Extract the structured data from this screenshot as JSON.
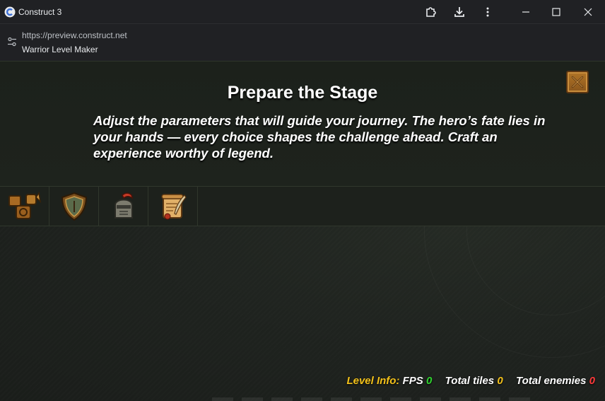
{
  "window": {
    "title": "Construct 3",
    "controls": {
      "extensions_icon": "puzzle-icon",
      "download_icon": "download-icon",
      "menu_icon": "more-vert-icon",
      "minimize_icon": "minimize-icon",
      "maximize_icon": "maximize-icon",
      "close_icon": "close-icon"
    }
  },
  "address": {
    "url": "https://preview.construct.net",
    "page_title": "Warrior Level Maker"
  },
  "game": {
    "title": "Prepare the Stage",
    "description": "Adjust the parameters that will guide your journey. The hero’s fate lies in your hands — every choice shapes the challenge ahead. Craft an experience worthy of legend.",
    "tabs": [
      {
        "icon": "map-layout-icon"
      },
      {
        "icon": "shield-icon"
      },
      {
        "icon": "knight-helmet-icon"
      },
      {
        "icon": "scroll-quill-icon"
      }
    ],
    "footer": {
      "level_info_label": "Level Info:",
      "fps_label": "FPS",
      "fps_value": "0",
      "tiles_label": "Total tiles",
      "tiles_value": "0",
      "enemies_label": "Total enemies",
      "enemies_value": "0"
    },
    "colors": {
      "gold": "#f4c21a",
      "green": "#2fd42f",
      "red": "#ff3b3b",
      "close_button": "#b07427"
    }
  }
}
